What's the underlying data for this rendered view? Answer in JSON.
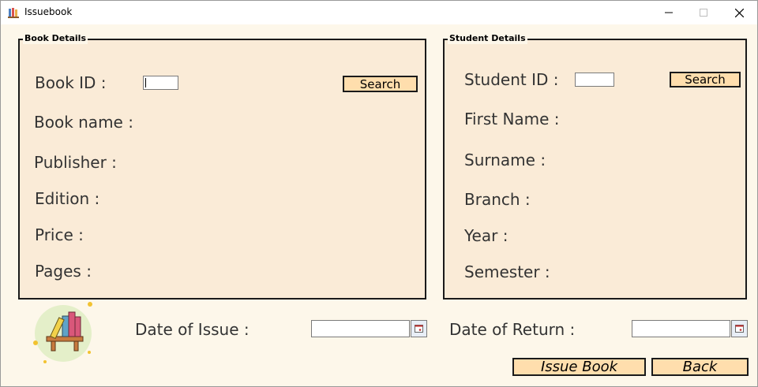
{
  "window": {
    "title": "Issuebook"
  },
  "book_details": {
    "legend": "Book Details",
    "book_id_label": "Book ID :",
    "book_id_value": "",
    "search_label": "Search",
    "book_name_label": "Book name :",
    "publisher_label": "Publisher :",
    "edition_label": "Edition :",
    "price_label": "Price :",
    "pages_label": "Pages :"
  },
  "student_details": {
    "legend": "Student Details",
    "student_id_label": "Student ID :",
    "student_id_value": "",
    "search_label": "Search",
    "first_name_label": "First Name :",
    "surname_label": "Surname :",
    "branch_label": "Branch :",
    "year_label": "Year :",
    "semester_label": "Semester :"
  },
  "footer": {
    "date_of_issue_label": "Date of Issue :",
    "date_of_issue_value": "",
    "date_of_return_label": "Date of Return :",
    "date_of_return_value": "",
    "issue_book_label": "Issue Book",
    "back_label": "Back"
  },
  "colors": {
    "panel_bg": "#faebd7",
    "button_bg": "#ffdead",
    "window_bg": "#fdf7ea"
  }
}
